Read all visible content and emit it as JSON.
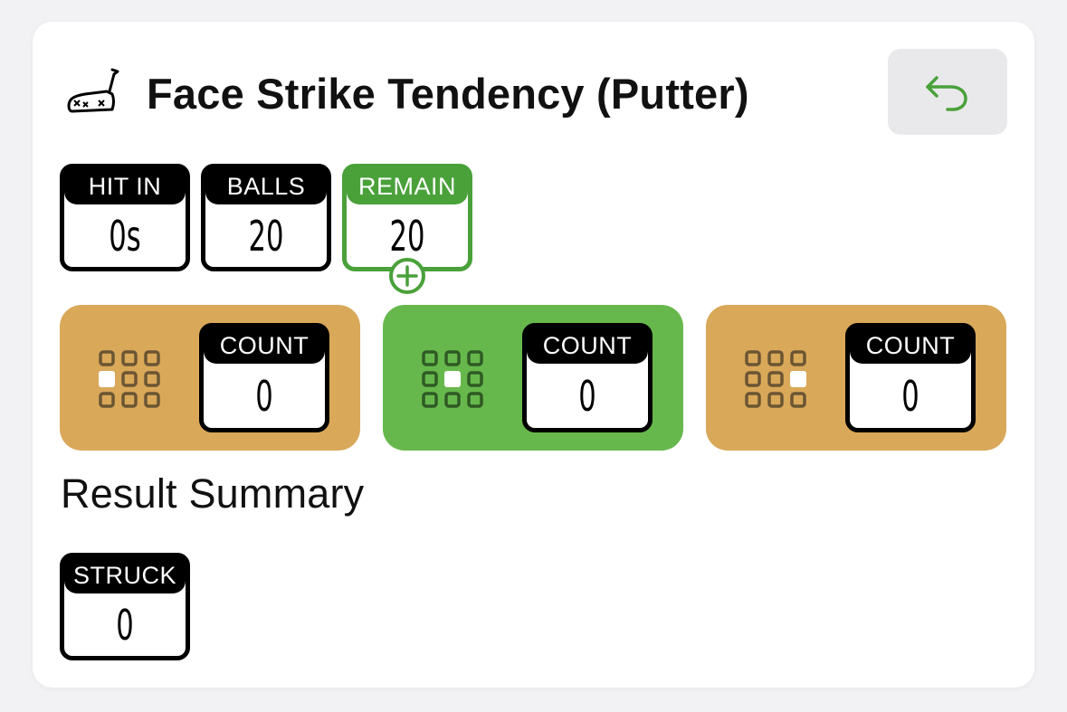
{
  "header": {
    "title": "Face Strike Tendency (Putter)",
    "icon": "putter-icon",
    "back_icon": "undo-arrow-icon"
  },
  "stats": {
    "hit_in": {
      "label": "HIT IN",
      "value": "0s"
    },
    "balls": {
      "label": "BALLS",
      "value": "20"
    },
    "remain": {
      "label": "REMAIN",
      "value": "20"
    }
  },
  "zones": [
    {
      "label": "COUNT",
      "value": "0",
      "zone": "heel",
      "color": "#d9a859"
    },
    {
      "label": "COUNT",
      "value": "0",
      "zone": "center",
      "color": "#67b84c"
    },
    {
      "label": "COUNT",
      "value": "0",
      "zone": "toe",
      "color": "#d9a859"
    }
  ],
  "summary": {
    "title": "Result Summary",
    "struck": {
      "label": "STRUCK",
      "value": "0"
    }
  },
  "colors": {
    "accent_green": "#4aa13a",
    "zone_gold": "#d9a859",
    "zone_green": "#67b84c"
  }
}
